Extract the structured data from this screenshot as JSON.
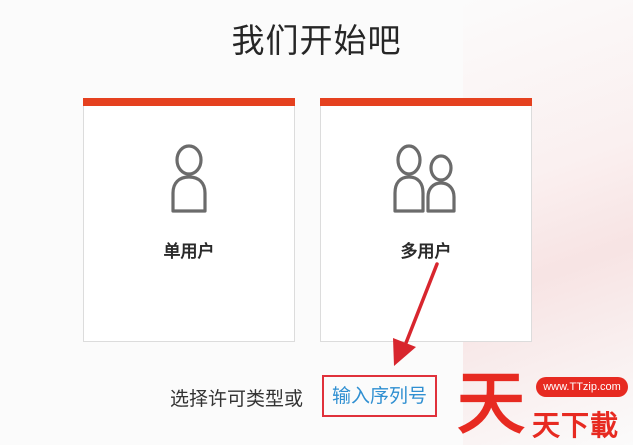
{
  "page": {
    "title": "我们开始吧"
  },
  "cards": {
    "single": {
      "label": "单用户",
      "icon": "single-user-icon"
    },
    "multi": {
      "label": "多用户",
      "icon": "multi-user-icon"
    }
  },
  "footer": {
    "prefix": "选择许可类型或",
    "link": "输入序列号"
  },
  "watermark": {
    "badge": "www.TTzip.com",
    "big_char": "天",
    "sub_text": "天下載"
  },
  "colors": {
    "accent_bar": "#e5411f",
    "link": "#2f8fd1",
    "highlight_box": "#e0313b",
    "watermark": "#e72a21"
  }
}
